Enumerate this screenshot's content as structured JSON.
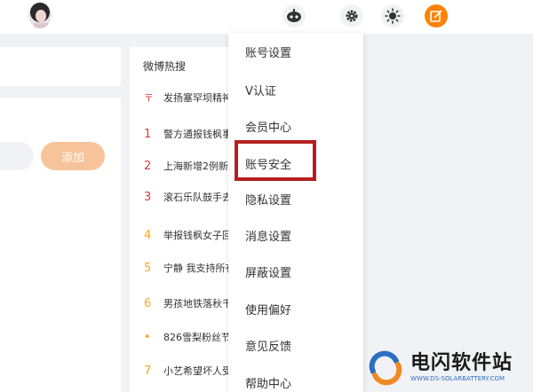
{
  "header": {
    "icons": [
      "avatar",
      "bot-icon",
      "gear-icon",
      "sun-icon",
      "edit-icon"
    ]
  },
  "left": {
    "add_button": "添加"
  },
  "hot_search": {
    "title": "微博热搜",
    "items": [
      {
        "rank": "",
        "text": "发扬塞罕坝精神",
        "pinned": true
      },
      {
        "rank": "1",
        "text": "警方通报钱枫事"
      },
      {
        "rank": "2",
        "text": "上海新增2例新"
      },
      {
        "rank": "3",
        "text": "滚石乐队鼓手去"
      },
      {
        "rank": "4",
        "text": "举报钱枫女子回"
      },
      {
        "rank": "5",
        "text": "宁静 我支持所有"
      },
      {
        "rank": "6",
        "text": "男孩地铁落秋千"
      },
      {
        "rank": "•",
        "text": "826雪梨粉丝节"
      },
      {
        "rank": "7",
        "text": "小艺希望坏人受"
      }
    ]
  },
  "settings_menu": {
    "items": [
      "账号设置",
      "V认证",
      "会员中心",
      "账号安全",
      "隐私设置",
      "消息设置",
      "屏蔽设置",
      "使用偏好",
      "意见反馈",
      "帮助中心"
    ],
    "highlighted": "账号安全"
  },
  "watermark": {
    "title": "电闪软件站",
    "subtitle": "WWW.DS-SOLARBATTERY.COM"
  },
  "colors": {
    "accent": "#ff8200",
    "highlight_border": "#b51f1f",
    "rank_red": "#e0393e",
    "rank_orange": "#f6a623"
  }
}
